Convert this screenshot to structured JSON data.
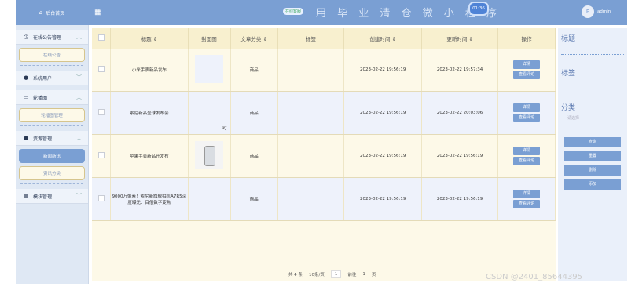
{
  "sidebar": {
    "home_label": "后台首页",
    "sections": [
      {
        "label": "在线公告管理",
        "chev": "︿"
      },
      {
        "label": "在线公告"
      },
      {
        "label": "系统用户",
        "chev": "﹀"
      },
      {
        "label": "轮播图",
        "chev": "︿"
      },
      {
        "label": "轮播图管理"
      },
      {
        "label": "资源管理",
        "chev": "︿"
      },
      {
        "label": "新闻新讯"
      },
      {
        "label": "资讯分类"
      },
      {
        "label": "模块管理",
        "chev": "﹀"
      }
    ]
  },
  "topbar": {
    "title": "用 毕 业 清 仓 微 小 程 序",
    "badge": "在线客服",
    "time": "01:36",
    "user": "admin",
    "avatar": "P"
  },
  "table": {
    "headers": [
      "标题 ⇕",
      "封面图",
      "文章分类 ⇕",
      "标签",
      "创建时间 ⇕",
      "更新时间 ⇕",
      "操作"
    ],
    "rows": [
      {
        "title": "小米手表新品发布",
        "category": "商品",
        "tags": "",
        "created": "2023-02-22 19:56:19",
        "updated": "2023-02-22 19:57:34",
        "btn1": "详情",
        "btn2": "查看评论"
      },
      {
        "title": "索尼新品全球发布会",
        "category": "商品",
        "tags": "",
        "created": "2023-02-22 19:56:19",
        "updated": "2023-02-22 20:03:06",
        "btn1": "详情",
        "btn2": "查看评论"
      },
      {
        "title": "苹果手表新品开发布",
        "category": "商品",
        "tags": "",
        "created": "2023-02-22 19:56:19",
        "updated": "2023-02-22 19:56:19",
        "btn1": "详情",
        "btn2": "查看评论"
      },
      {
        "title": "9000万像素！索尼新旗舰相机A7R5深度曝光：百倍数字变焦",
        "category": "商品",
        "tags": "",
        "created": "2023-02-22 19:56:19",
        "updated": "2023-02-22 19:56:19",
        "btn1": "详情",
        "btn2": "查看评论"
      }
    ]
  },
  "pager": {
    "total": "共 4 条",
    "per_page": "10条/页",
    "page": "1",
    "goto_prefix": "前往",
    "goto_page": "1",
    "goto_suffix": "页"
  },
  "right_panel": {
    "label1": "标题",
    "label2": "标签",
    "label3": "分类",
    "placeholder": "请选择",
    "buttons": [
      "查询",
      "重置",
      "删除",
      "添加"
    ]
  },
  "watermark": "CSDN @2401_85644395"
}
